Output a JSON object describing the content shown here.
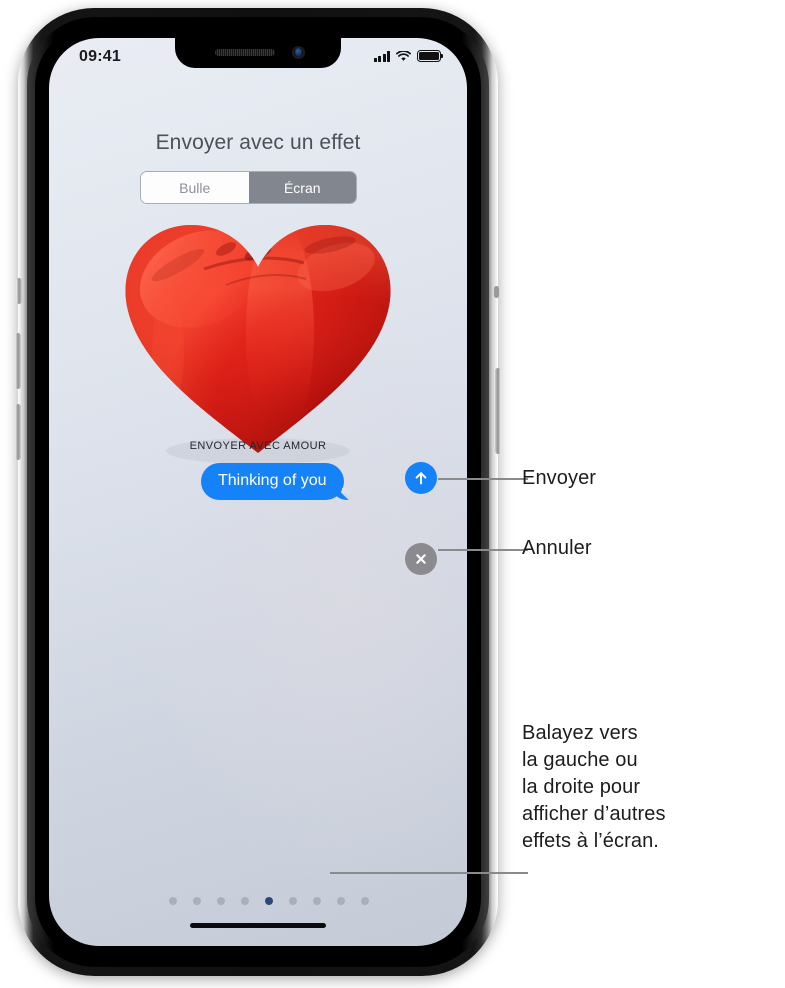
{
  "device": {
    "status_bar": {
      "time": "09:41",
      "signal_icon": "cellular-signal-icon",
      "wifi_icon": "wifi-icon",
      "battery_icon": "battery-full-icon"
    },
    "notch": {
      "speaker_icon": "earpiece-speaker-icon",
      "camera_icon": "front-camera-icon"
    },
    "home_indicator": "home-indicator"
  },
  "sheet": {
    "title": "Envoyer avec un effet",
    "segmented_control": {
      "options": [
        {
          "label": "Bulle",
          "selected": false
        },
        {
          "label": "Écran",
          "selected": true
        }
      ]
    },
    "effect": {
      "preview_icon": "red-heart-balloon",
      "name": "ENVOYER AVEC AMOUR"
    },
    "message": {
      "bubble_text": "Thinking of you",
      "bubble_color": "#1682f7"
    },
    "actions": [
      {
        "name": "send",
        "icon": "arrow-up-icon",
        "color": "#1682f7"
      },
      {
        "name": "cancel",
        "icon": "close-x-icon",
        "color": "#8b8b8f"
      }
    ],
    "page_dots": {
      "count": 9,
      "active_index": 4,
      "active_color": "#2c4a77",
      "inactive_color": "#a9b0bd"
    }
  },
  "callouts": [
    {
      "id": "send",
      "text": "Envoyer"
    },
    {
      "id": "cancel",
      "text": "Annuler"
    },
    {
      "id": "swipe",
      "lines": [
        "Balayez vers",
        "la gauche ou",
        "la droite pour",
        "afficher d’autres",
        "effets à l’écran."
      ]
    }
  ]
}
